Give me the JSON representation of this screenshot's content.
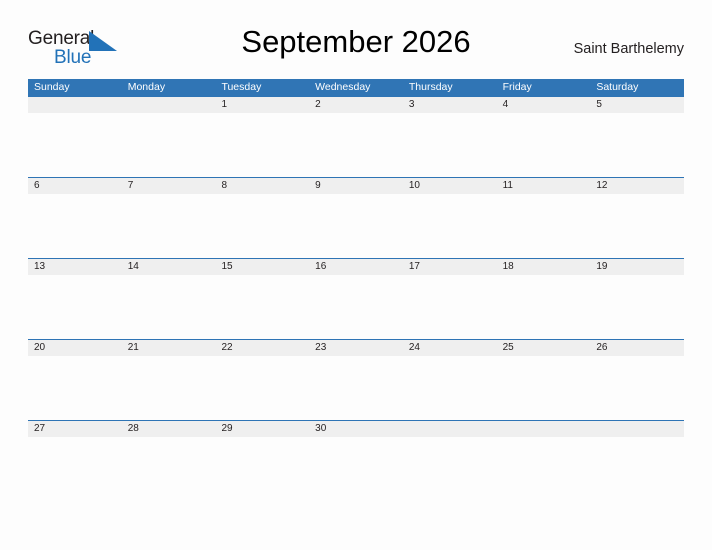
{
  "brand": {
    "word_one": "General",
    "word_two": "Blue",
    "triangle_icon": "triangle-icon",
    "color_dark": "#231f20",
    "color_blue": "#2272b8"
  },
  "header": {
    "title": "September 2026",
    "location": "Saint Barthelemy"
  },
  "calendar": {
    "accent_color": "#3075b5",
    "line_color": "#2e74b5",
    "band_color": "#efefef",
    "day_names": [
      "Sunday",
      "Monday",
      "Tuesday",
      "Wednesday",
      "Thursday",
      "Friday",
      "Saturday"
    ],
    "weeks": [
      [
        "",
        "",
        "1",
        "2",
        "3",
        "4",
        "5"
      ],
      [
        "6",
        "7",
        "8",
        "9",
        "10",
        "11",
        "12"
      ],
      [
        "13",
        "14",
        "15",
        "16",
        "17",
        "18",
        "19"
      ],
      [
        "20",
        "21",
        "22",
        "23",
        "24",
        "25",
        "26"
      ],
      [
        "27",
        "28",
        "29",
        "30",
        "",
        "",
        ""
      ]
    ]
  }
}
